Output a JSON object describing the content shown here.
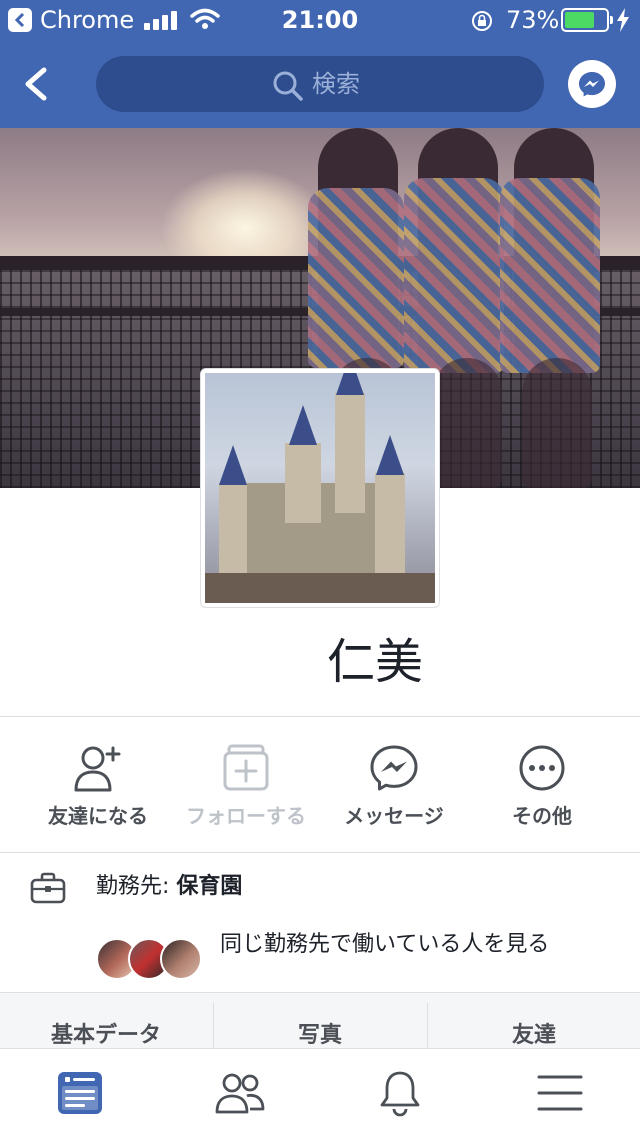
{
  "status_bar": {
    "back_app_label": "Chrome",
    "time": "21:00",
    "battery_percent": "73%",
    "battery_level": 0.73
  },
  "nav": {
    "search_placeholder": "検索"
  },
  "profile": {
    "name": "仁美"
  },
  "actions": [
    {
      "label": "友達になる",
      "icon": "add-friend-icon",
      "enabled": true
    },
    {
      "label": "フォローする",
      "icon": "follow-icon",
      "enabled": false
    },
    {
      "label": "メッセージ",
      "icon": "messenger-icon",
      "enabled": true
    },
    {
      "label": "その他",
      "icon": "more-icon",
      "enabled": true
    }
  ],
  "work": {
    "prefix": "勤務先: ",
    "workplace": "保育園",
    "coworkers_link": "同じ勤務先で働いている人を見る"
  },
  "tabs": [
    "基本データ",
    "写真",
    "友達"
  ],
  "tabbar": [
    {
      "icon": "news-feed-icon",
      "active": true
    },
    {
      "icon": "friends-icon",
      "active": false
    },
    {
      "icon": "notifications-icon",
      "active": false
    },
    {
      "icon": "menu-icon",
      "active": false
    }
  ],
  "colors": {
    "brand": "#4267b2",
    "nav_search": "#2d4d8e",
    "battery": "#4cd964",
    "active_tab_icon": "#4267b2"
  }
}
